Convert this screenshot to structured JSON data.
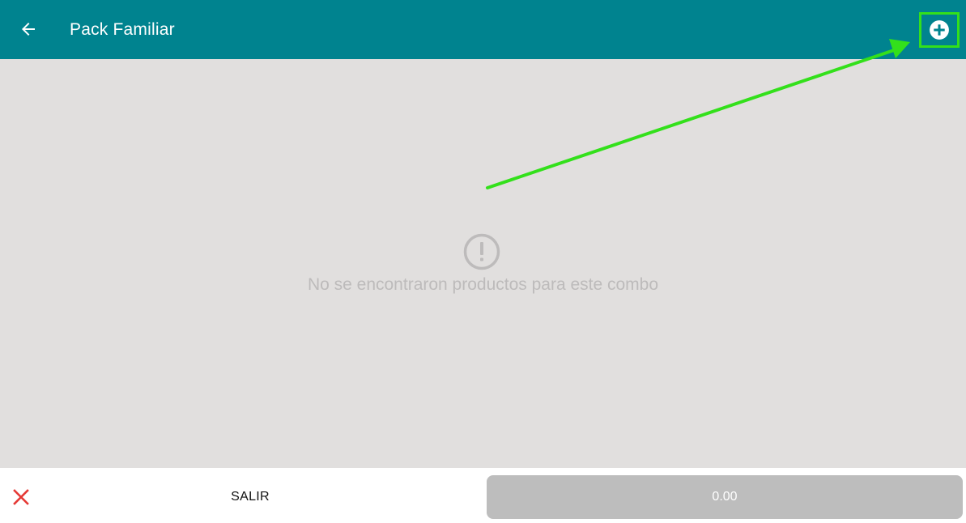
{
  "header": {
    "title": "Pack Familiar",
    "back_icon": "arrow-left-icon",
    "add_icon": "plus-circle-icon",
    "background_color": "#00838f"
  },
  "empty_state": {
    "icon": "alert-circle-icon",
    "message": "No se encontraron productos para este combo"
  },
  "footer": {
    "cancel_icon": "close-icon",
    "cancel_color": "#e53935",
    "exit_label": "SALIR",
    "total_label": "0.00"
  },
  "annotation": {
    "color": "#33e01b"
  }
}
